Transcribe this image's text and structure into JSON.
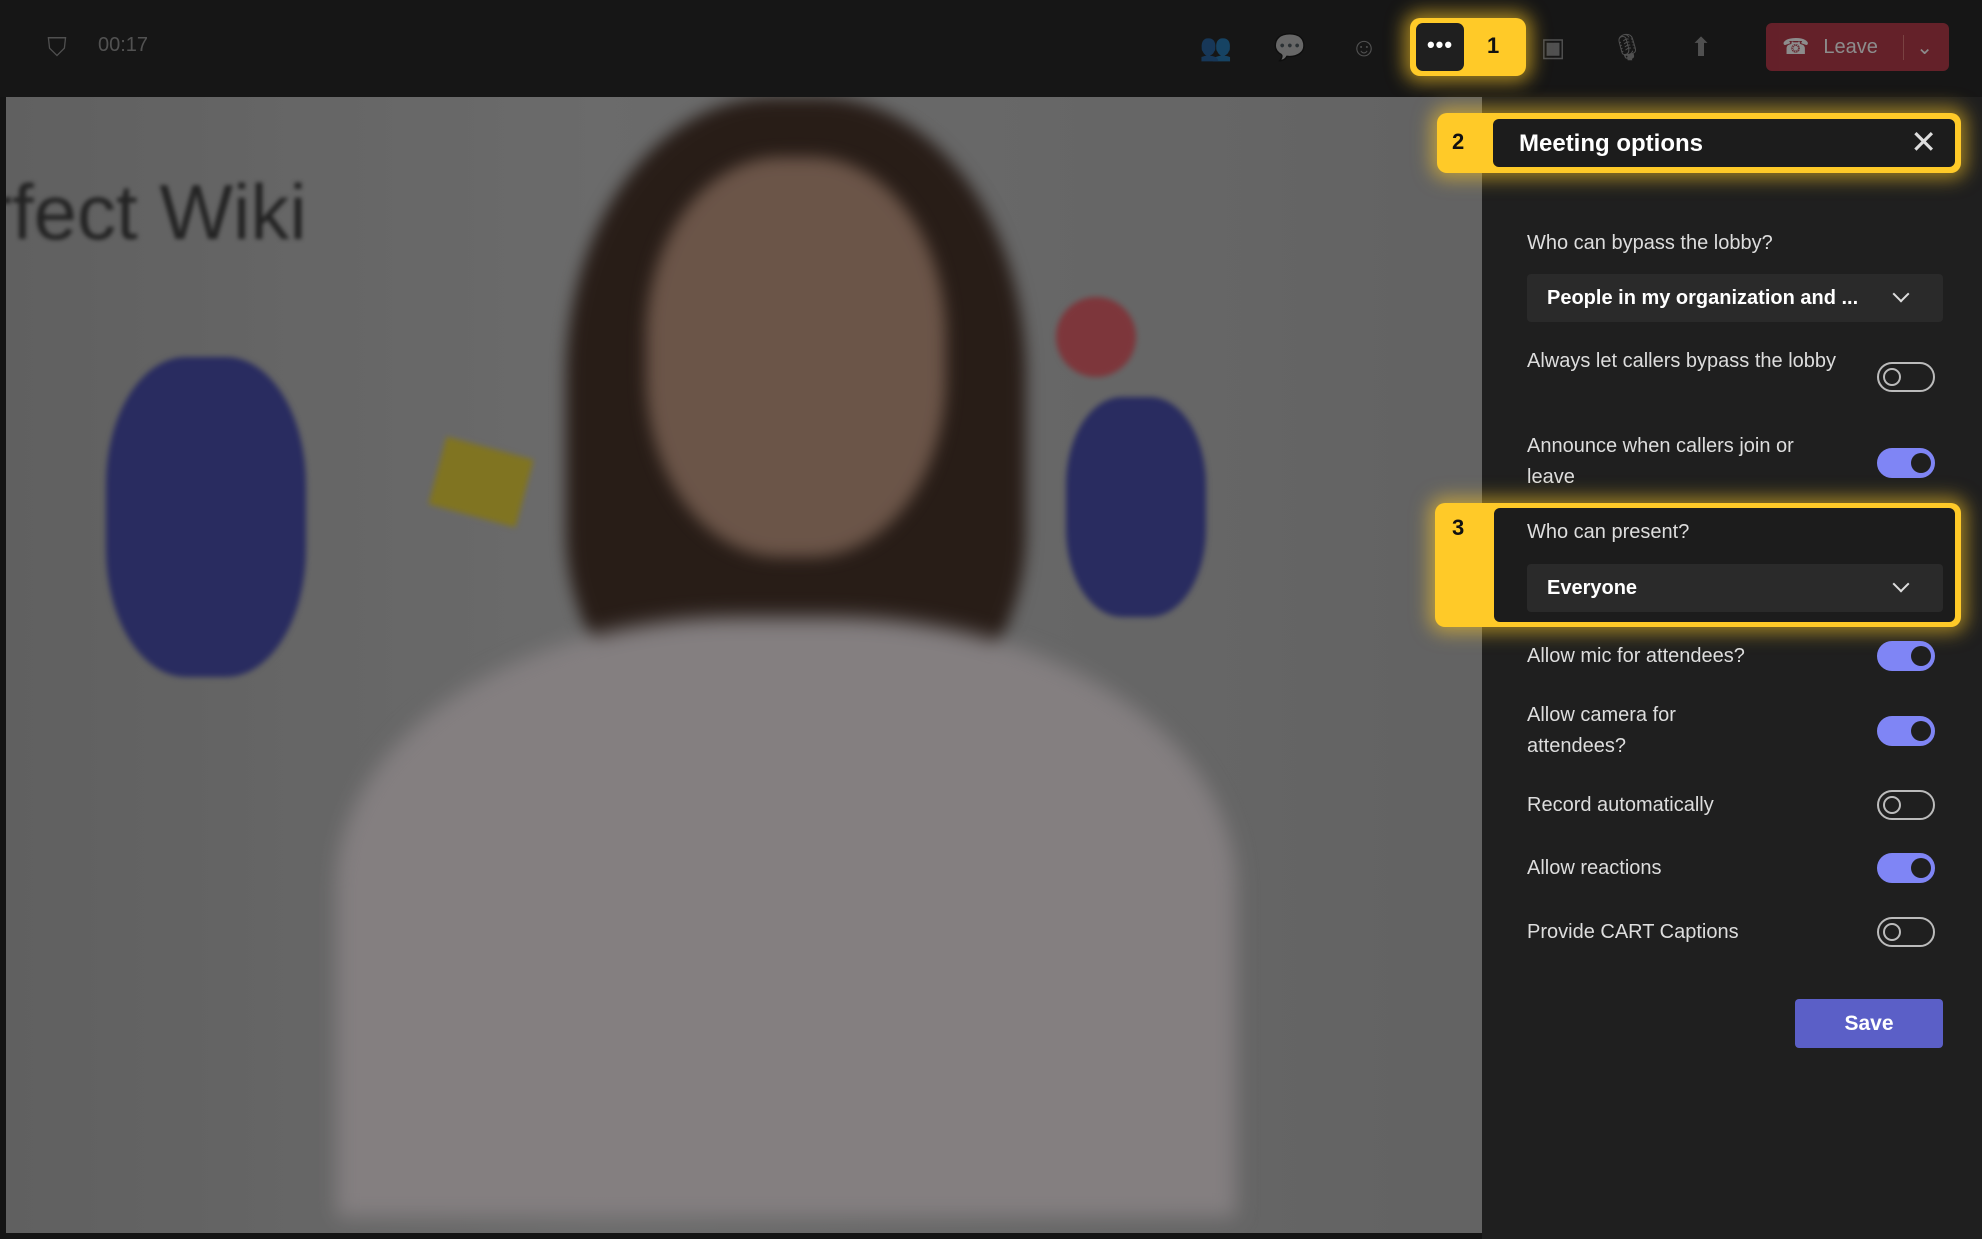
{
  "topbar": {
    "timer": "00:17",
    "more_badge": "1",
    "more_label": "•••",
    "leave_label": "Leave",
    "icons": [
      "shield-icon",
      "people-icon",
      "chat-icon",
      "reactions-icon",
      "camera-off-icon",
      "mic-icon",
      "share-icon",
      "phone-icon",
      "chevron-down-icon"
    ]
  },
  "video": {
    "background_text": "rfect Wiki"
  },
  "panel": {
    "badge": "2",
    "title": "Meeting options",
    "lobby_label": "Who can bypass the lobby?",
    "lobby_value": "People in my organization and ...",
    "present_badge": "3",
    "present_label": "Who can present?",
    "present_value": "Everyone",
    "toggles": [
      {
        "label": "Always let callers bypass the lobby",
        "on": false
      },
      {
        "label": "Announce when callers join or leave",
        "on": true
      },
      {
        "label": "Allow mic for attendees?",
        "on": true
      },
      {
        "label": "Allow camera for attendees?",
        "on": true
      },
      {
        "label": "Record automatically",
        "on": false
      },
      {
        "label": "Allow reactions",
        "on": true
      },
      {
        "label": "Provide CART Captions",
        "on": false
      }
    ],
    "save_label": "Save"
  },
  "colors": {
    "highlight": "#ffca28",
    "accent": "#7f85f5",
    "save": "#5b5fc7",
    "leave": "#a52a3a"
  }
}
